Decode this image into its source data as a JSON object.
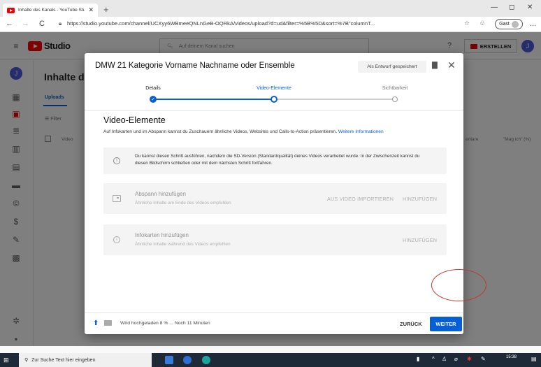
{
  "browser": {
    "tab_title": "Inhalte des Kanals - YouTube Stu",
    "tab_close": "✕",
    "new_tab": "+",
    "minimize": "—",
    "maximize": "◻",
    "close": "✕",
    "back": "←",
    "forward": "→",
    "reload": "C",
    "url": "https://studio.youtube.com/channel/UCXyy6WBmeeQNLnGeB-OQRkA/videos/upload?d=ud&filter=%5B%5D&sort=%7B\"columnT...",
    "guest_label": "Gast",
    "more": "..."
  },
  "studio": {
    "logo_text": "Studio",
    "search_placeholder": "Auf deinem Kanal suchen",
    "create_label": "ERSTELLEN",
    "avatar_letter": "J",
    "page_title": "Inhalte de",
    "tab_uploads": "Uploads",
    "filter_label": "Filter",
    "col_video": "Video",
    "col_comments": "entare",
    "col_likes": "\"Mag ich\" (%)",
    "sidebar_avatar": "J"
  },
  "modal": {
    "title": "DMW 21 Kategorie Vorname Nachname oder Ensemble",
    "draft_badge": "Als Entwurf gespeichert",
    "steps": [
      {
        "label": "Details",
        "state": "done"
      },
      {
        "label": "Video-Elemente",
        "state": "current"
      },
      {
        "label": "Sichtbarkeit",
        "state": "todo"
      }
    ],
    "section_title": "Video-Elemente",
    "section_desc": "Auf Infokarten und im Abspann kannst du Zuschauern ähnliche Videos, Websites und Calls-to-Action präsentieren.",
    "section_link": "Weitere Informationen",
    "info_notice": "Du kannst diesen Schritt ausführen, nachdem die SD-Version (Standardqualität) deines Videos verarbeitet wurde. In der Zwischenzeit kannst du diesen Bildschirm schließen oder mit dem nächsten Schritt fortfahren.",
    "endscreen": {
      "title": "Abspann hinzufügen",
      "subtitle": "Ähnliche Inhalte am Ende des Videos empfehlen",
      "import_label": "AUS VIDEO IMPORTIEREN",
      "add_label": "HINZUFÜGEN"
    },
    "cards": {
      "title": "Infokarten hinzufügen",
      "subtitle": "Ähnliche Inhalte während des Videos empfehlen",
      "add_label": "HINZUFÜGEN"
    },
    "upload_status": "Wird hochgeladen 8 % ... Noch 11 Minuten",
    "back_label": "ZURÜCK",
    "next_label": "WEITER"
  },
  "taskbar": {
    "search_placeholder": "Zur Suche Text hier eingeben",
    "time": "15:38"
  },
  "colors": {
    "accent": "#065fd4",
    "annotation": "#c0392b",
    "youtube_red": "#ff0000"
  }
}
